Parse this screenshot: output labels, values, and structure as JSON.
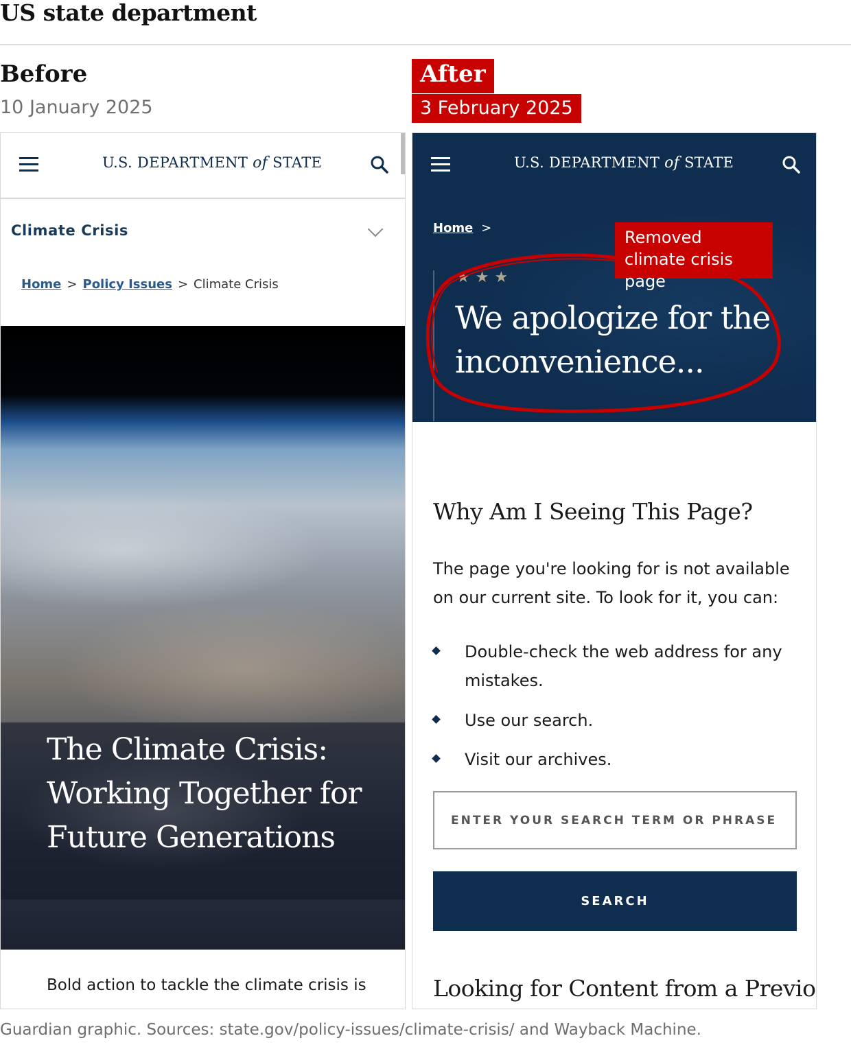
{
  "graphic_title": "US state department",
  "before": {
    "label": "Before",
    "date": "10 January 2025",
    "header": {
      "logo_pre": "U.S. DEPARTMENT ",
      "logo_of": "of",
      "logo_post": " STATE"
    },
    "section_title": "Climate Crisis",
    "breadcrumb": {
      "home": "Home",
      "policy": "Policy Issues",
      "current": "Climate Crisis",
      "sep": ">"
    },
    "hero_title": "The Climate Crisis: Working Together for Future Generations",
    "body_text": "Bold action to tackle the climate crisis is"
  },
  "after": {
    "label": "After",
    "date": "3 February 2025",
    "header": {
      "logo_pre": "U.S. DEPARTMENT ",
      "logo_of": "of",
      "logo_post": " STATE"
    },
    "breadcrumb": {
      "home": "Home",
      "sep": ">"
    },
    "stars": "★★★",
    "apology": "We apologize for the inconvenience...",
    "callout": "Removed climate crisis page",
    "why_heading": "Why Am I Seeing This Page?",
    "paragraph": "The page you're looking for is not available on our current site. To look for it, you can:",
    "list": [
      "Double-check the web address for any mistakes.",
      "Use our search.",
      "Visit our archives."
    ],
    "search_placeholder": "ENTER YOUR SEARCH TERM OR PHRASE",
    "search_button": "SEARCH",
    "previous_heading": "Looking for Content from a Previous"
  },
  "source_note": "Guardian graphic. Sources: state.gov/policy-issues/climate-crisis/ and Wayback Machine.",
  "colors": {
    "guardian_red": "#c70000",
    "state_navy": "#0f2d4e",
    "link_blue": "#2a5a8c"
  },
  "icons": [
    "hamburger-menu-icon",
    "search-icon",
    "chevron-down-icon",
    "diamond-bullet-icon"
  ]
}
